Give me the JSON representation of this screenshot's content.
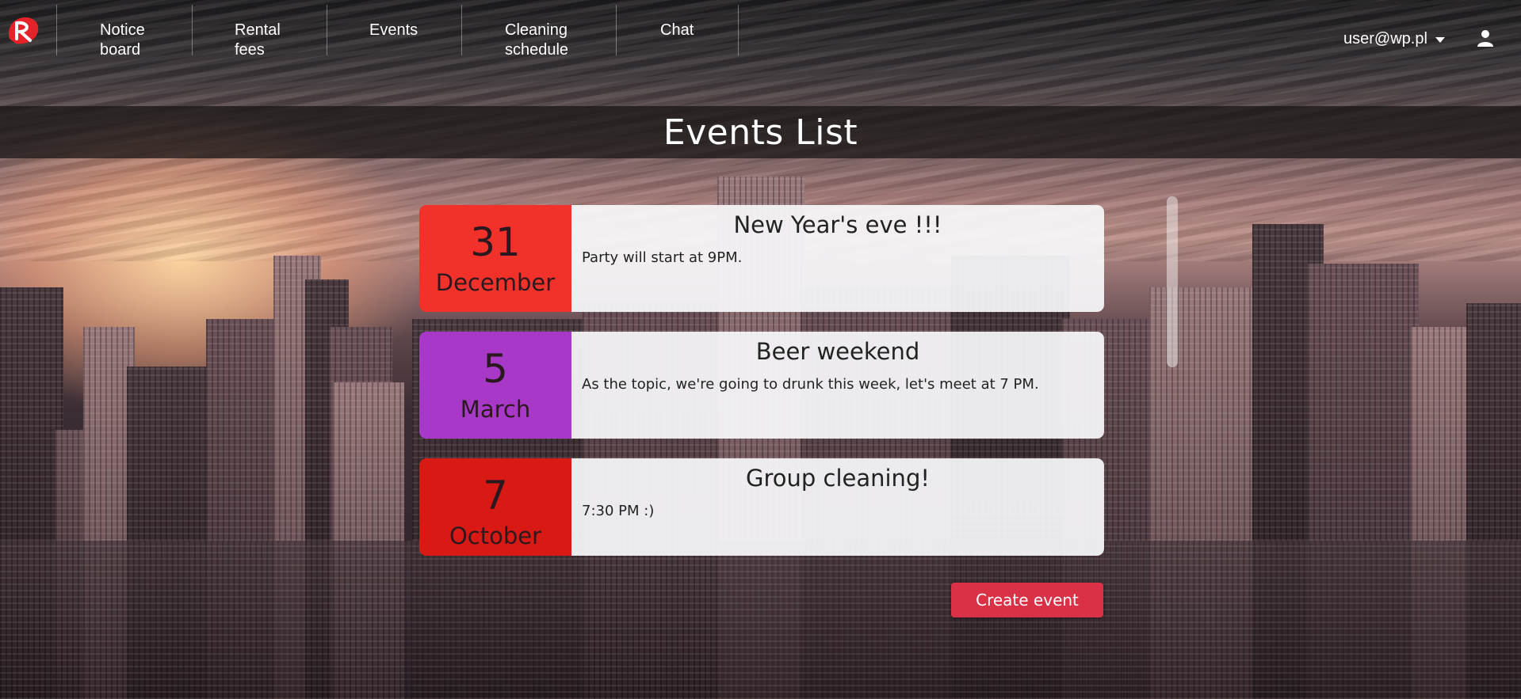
{
  "nav": {
    "items": [
      {
        "label": "Notice\nboard"
      },
      {
        "label": "Rental\nfees"
      },
      {
        "label": "Events"
      },
      {
        "label": "Cleaning\nschedule"
      },
      {
        "label": "Chat"
      }
    ],
    "user_email": "user@wp.pl",
    "logo_icon": "r-logo-icon",
    "user_icon": "user-icon"
  },
  "page": {
    "title": "Events List"
  },
  "events": [
    {
      "day": "31",
      "month": "December",
      "title": "New Year's eve !!!",
      "description": "Party will start at 9PM.",
      "color": "#f2312a"
    },
    {
      "day": "5",
      "month": "March",
      "title": "Beer weekend",
      "description": "As the topic, we're going to drunk this week, let's meet at 7 PM.",
      "color": "#a839c8"
    },
    {
      "day": "7",
      "month": "October",
      "title": "Group cleaning!",
      "description": "7:30 PM :)",
      "color": "#d91914"
    }
  ],
  "actions": {
    "create_event_label": "Create event",
    "accent_color": "#d93146"
  }
}
